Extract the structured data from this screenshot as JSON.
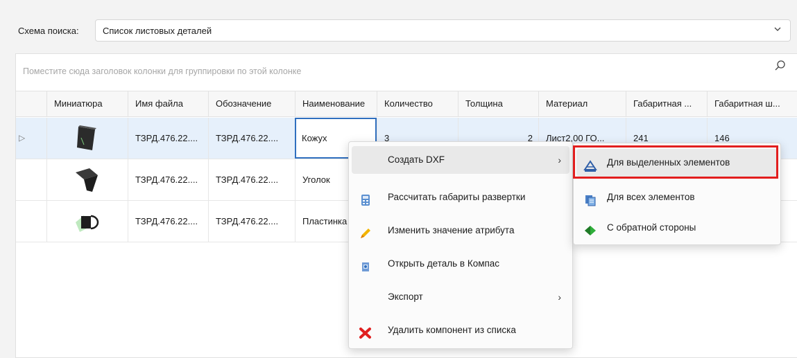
{
  "search": {
    "label": "Схема поиска:",
    "value": "Список листовых деталей",
    "dropdown_icon": "chevron-down-icon"
  },
  "grid": {
    "group_hint": "Поместите сюда заголовок колонки для группировки по этой колонке",
    "search_icon": "search-icon",
    "columns": [
      "Миниатюра",
      "Имя файла",
      "Обозначение",
      "Наименование",
      "Количество",
      "Толщина",
      "Материал",
      "Габаритная ...",
      "Габаритная ш..."
    ],
    "rows": [
      {
        "file": "ТЗРД.476.22....",
        "designation": "ТЗРД.476.22....",
        "name": "Кожух",
        "qty": "3",
        "thickness": "2",
        "material": "Лист2,00 ГО...",
        "dim1": "241",
        "dim2": "146"
      },
      {
        "file": "ТЗРД.476.22....",
        "designation": "ТЗРД.476.22....",
        "name": "Уголок"
      },
      {
        "file": "ТЗРД.476.22....",
        "designation": "ТЗРД.476.22....",
        "name": "Пластинка"
      }
    ]
  },
  "context_menu": {
    "items": [
      {
        "label": "Создать DXF",
        "icon": ""
      },
      {
        "label": "Рассчитать габариты развертки",
        "icon": "calculator-icon"
      },
      {
        "label": "Изменить значение атрибута",
        "icon": "pencil-icon"
      },
      {
        "label": "Открыть деталь в Компас",
        "icon": "open-document-icon"
      },
      {
        "label": "Экспорт",
        "icon": ""
      },
      {
        "label": "Удалить компонент из списка",
        "icon": "delete-x-icon"
      }
    ]
  },
  "submenu": {
    "items": [
      {
        "label": "Для выделенных элементов",
        "icon": "dxf-selected-icon"
      },
      {
        "label": "Для всех элементов",
        "icon": "dxf-all-icon"
      },
      {
        "label": "С обратной стороны",
        "icon": "flip-side-icon"
      }
    ]
  },
  "colors": {
    "accent": "#2f6fbf",
    "highlight": "#e21e1e",
    "selected_row": "#e6f0fb"
  }
}
